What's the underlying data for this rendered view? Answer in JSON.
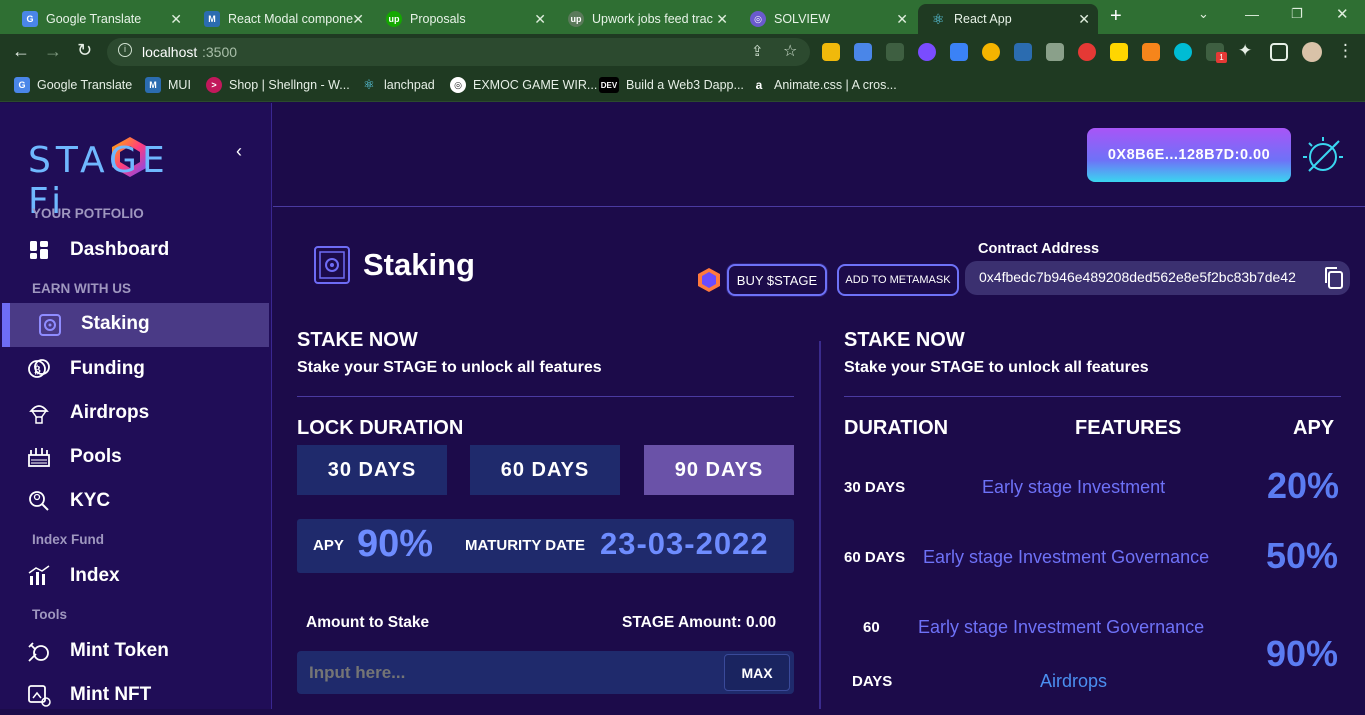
{
  "browser": {
    "tabs": [
      {
        "title": "Google Translate",
        "active": false
      },
      {
        "title": "React Modal compone",
        "active": false
      },
      {
        "title": "Proposals",
        "active": false
      },
      {
        "title": "Upwork jobs feed trac",
        "active": false
      },
      {
        "title": "SOLVIEW",
        "active": false
      },
      {
        "title": "React App",
        "active": true
      }
    ],
    "url_host": "localhost",
    "url_port": ":3500",
    "bookmarks": [
      "Google Translate",
      "MUI",
      "Shop | Shellngn - W...",
      "lanchpad",
      "EXMOC GAME WIR...",
      "Build a Web3 Dapp...",
      "Animate.css | A cros..."
    ],
    "extension_badge": "1",
    "colors": {
      "tabbar": "#2f6f33",
      "toolbar": "#1f3a22"
    }
  },
  "sidebar": {
    "logo": "STAGE Fi",
    "sections": {
      "portfolio": "YOUR POTFOLIO",
      "earn": "EARN WITH US",
      "index_fund": "Index Fund",
      "tools": "Tools"
    },
    "items": {
      "dashboard": "Dashboard",
      "staking": "Staking",
      "funding": "Funding",
      "airdrops": "Airdrops",
      "pools": "Pools",
      "kyc": "KYC",
      "index": "Index",
      "mint_token": "Mint Token",
      "mint_nft": "Mint NFT"
    }
  },
  "header": {
    "wallet": "0X8B6E...128B7D:0.00"
  },
  "page": {
    "title": "Staking",
    "buy_label": "BUY $STAGE",
    "metamask_label": "ADD TO METAMASK",
    "contract_label": "Contract Address",
    "contract_address": "0x4fbedc7b946e489208ded562e8e5f2bc83b7de42"
  },
  "stake_panel": {
    "heading": "STAKE NOW",
    "subheading": "Stake your STAGE to unlock all features",
    "lock_label": "LOCK DURATION",
    "durations": [
      "30 DAYS",
      "60 DAYS",
      "90 DAYS"
    ],
    "selected_duration": "90 DAYS",
    "apy_label": "APY",
    "apy_value": "90%",
    "maturity_label": "MATURITY DATE",
    "maturity_value": "23-03-2022",
    "amount_label": "Amount to Stake",
    "stage_amount": "STAGE Amount: 0.00",
    "input_placeholder": "Input here...",
    "max_label": "MAX"
  },
  "info_panel": {
    "heading": "STAKE NOW",
    "subheading": "Stake your STAGE to unlock all features",
    "columns": [
      "DURATION",
      "FEATURES",
      "APY"
    ],
    "rows": [
      {
        "duration": "30 DAYS",
        "features": "Early stage Investment",
        "apy": "20%"
      },
      {
        "duration": "60 DAYS",
        "features": "Early stage Investment Governance",
        "apy": "50%"
      },
      {
        "duration_a": "60",
        "duration_b": "DAYS",
        "features_a": "Early stage Investment Governance",
        "features_b": "Airdrops",
        "apy": "90%"
      }
    ]
  }
}
